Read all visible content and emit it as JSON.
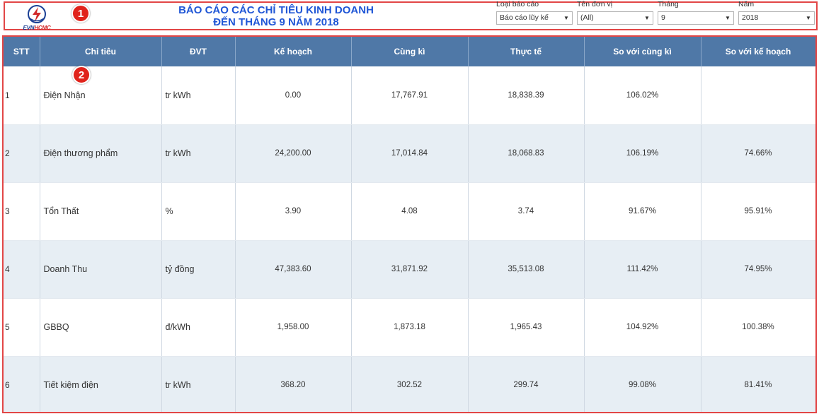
{
  "header": {
    "logo": {
      "evn": "EVN",
      "hcmc": "HCMC"
    },
    "badge_1": "1",
    "badge_2": "2",
    "title_line1": "BÁO CÁO CÁC CHỈ TIÊU KINH DOANH",
    "title_line2": "ĐẾN THÁNG 9 NĂM 2018",
    "title_color": "#1f56d6"
  },
  "filters": [
    {
      "label": "Loại báo cáo",
      "value": "Báo cáo lũy kế"
    },
    {
      "label": "Tên đơn vị",
      "value": "(All)"
    },
    {
      "label": "Tháng",
      "value": "9"
    },
    {
      "label": "Năm",
      "value": "2018"
    }
  ],
  "table": {
    "columns": [
      "STT",
      "Chỉ tiêu",
      "ĐVT",
      "Kế hoạch",
      "Cùng kì",
      "Thực tế",
      "So với cùng kì",
      "So với kế hoạch"
    ],
    "header_color": "#4f78a7",
    "rows": [
      {
        "stt": "1",
        "name": "Điện Nhận",
        "unit": "tr kWh",
        "plan": "0.00",
        "same_period": "17,767.91",
        "actual": "18,838.39",
        "vs_same": "106.02%",
        "vs_plan": ""
      },
      {
        "stt": "2",
        "name": "Điện thương phẩm",
        "unit": "tr kWh",
        "plan": "24,200.00",
        "same_period": "17,014.84",
        "actual": "18,068.83",
        "vs_same": "106.19%",
        "vs_plan": "74.66%"
      },
      {
        "stt": "3",
        "name": "Tổn Thất",
        "unit": "%",
        "plan": "3.90",
        "same_period": "4.08",
        "actual": "3.74",
        "vs_same": "91.67%",
        "vs_plan": "95.91%"
      },
      {
        "stt": "4",
        "name": "Doanh Thu",
        "unit": "tỷ đồng",
        "plan": "47,383.60",
        "same_period": "31,871.92",
        "actual": "35,513.08",
        "vs_same": "111.42%",
        "vs_plan": "74.95%"
      },
      {
        "stt": "5",
        "name": "GBBQ",
        "unit": "đ/kWh",
        "plan": "1,958.00",
        "same_period": "1,873.18",
        "actual": "1,965.43",
        "vs_same": "104.92%",
        "vs_plan": "100.38%"
      },
      {
        "stt": "6",
        "name": "Tiết kiệm điện",
        "unit": "tr kWh",
        "plan": "368.20",
        "same_period": "302.52",
        "actual": "299.74",
        "vs_same": "99.08%",
        "vs_plan": "81.41%"
      }
    ]
  }
}
